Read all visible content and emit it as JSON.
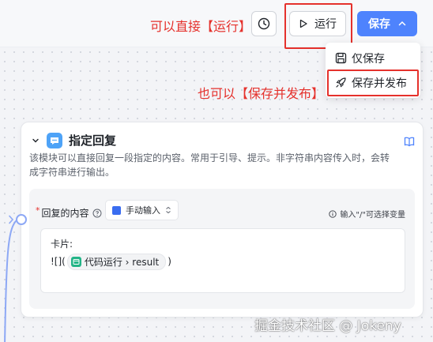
{
  "annotations": {
    "run_hint": "可以直接【运行】",
    "publish_hint": "也可以【保存并发布】"
  },
  "toolbar": {
    "history_icon": "clock-icon",
    "run_label": "运行",
    "save_label": "保存"
  },
  "save_menu": {
    "items": [
      {
        "label": "仅保存",
        "icon": "save-icon"
      },
      {
        "label": "保存并发布",
        "icon": "rocket-icon"
      }
    ]
  },
  "node": {
    "title": "指定回复",
    "icon": "chat-bubble-icon",
    "description": "该模块可以直接回复一段指定的内容。常用于引导、提示。非字符串内容传入时，会转成字符串进行输出。",
    "field_label": "回复的内容",
    "input_mode": "手动输入",
    "var_hint": "输入\"/\"可选择变量",
    "editor": {
      "line1": "卡片:",
      "prefix": "![](",
      "chip_label": "代码运行 › result",
      "suffix": ")"
    }
  },
  "watermark": "掘金技术社区 @ Jokeny",
  "colors": {
    "accent": "#4e83fd",
    "annotation_red": "#e5312c",
    "node_icon": "#4ea3f7",
    "chip_icon": "#23b487"
  }
}
